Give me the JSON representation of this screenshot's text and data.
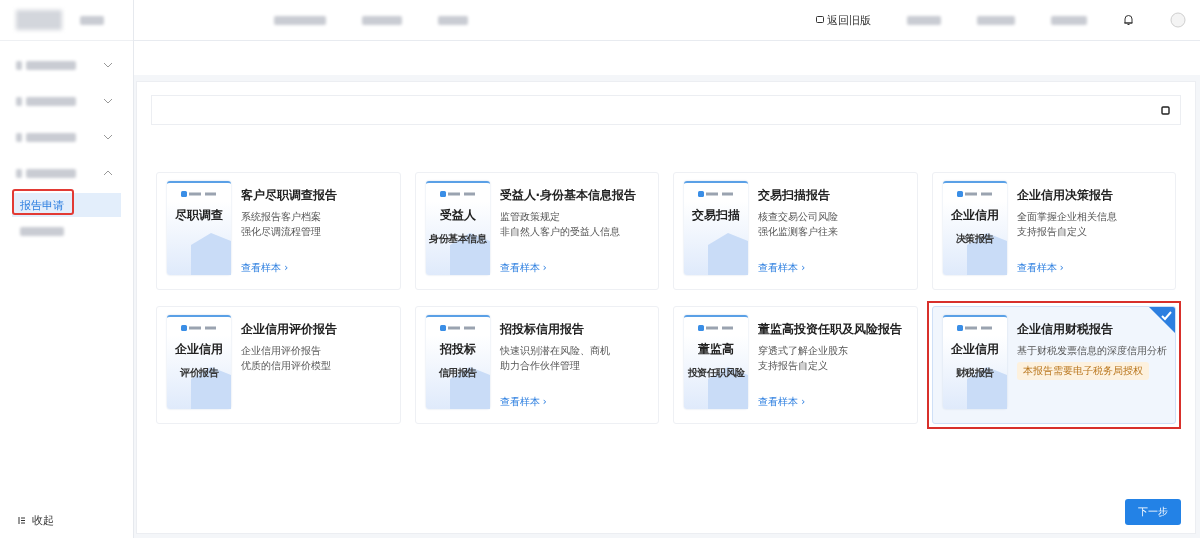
{
  "header": {
    "switch_link": "返回旧版"
  },
  "sidebar": {
    "groups": [
      {
        "expanded": false
      },
      {
        "expanded": false
      },
      {
        "expanded": false
      },
      {
        "expanded": true,
        "children": [
          {
            "label": "报告申请",
            "selected": true,
            "highlighted": true
          },
          {
            "selected": false
          }
        ]
      }
    ],
    "collapse": "收起"
  },
  "reports": [
    {
      "title": "客户尽职调查报告",
      "cover": [
        "尽职调查"
      ],
      "lines": [
        "系统报告客户档案",
        "强化尽调流程管理"
      ],
      "link": "查看样本 ›",
      "selected": false,
      "highlighted": false
    },
    {
      "title": "受益人·身份基本信息报告",
      "cover": [
        "受益人",
        "身份基本信息"
      ],
      "lines": [
        "监管政策规定",
        "非自然人客户的受益人信息"
      ],
      "link": "查看样本 ›",
      "selected": false,
      "highlighted": false
    },
    {
      "title": "交易扫描报告",
      "cover": [
        "交易扫描"
      ],
      "lines": [
        "核查交易公司风险",
        "强化监测客户往来"
      ],
      "link": "查看样本 ›",
      "selected": false,
      "highlighted": false
    },
    {
      "title": "企业信用决策报告",
      "cover": [
        "企业信用",
        "决策报告"
      ],
      "lines": [
        "全面掌握企业相关信息",
        "支持报告自定义"
      ],
      "link": "查看样本 ›",
      "selected": false,
      "highlighted": false
    },
    {
      "title": "企业信用评价报告",
      "cover": [
        "企业信用",
        "评价报告"
      ],
      "lines": [
        "企业信用评价报告",
        "优质的信用评价模型"
      ],
      "selected": false,
      "highlighted": false
    },
    {
      "title": "招投标信用报告",
      "cover": [
        "招投标",
        "信用报告"
      ],
      "lines": [
        "快速识别潜在风险、商机",
        "助力合作伙伴管理"
      ],
      "link": "查看样本 ›",
      "selected": false,
      "highlighted": false
    },
    {
      "title": "董监高投资任职及风险报告",
      "cover": [
        "董监高",
        "投资任职风险"
      ],
      "lines": [
        "穿透式了解企业股东",
        "支持报告自定义"
      ],
      "link": "查看样本 ›",
      "selected": false,
      "highlighted": false
    },
    {
      "title": "企业信用财税报告",
      "cover": [
        "企业信用",
        "财税报告"
      ],
      "lines": [
        "基于财税发票信息的深度信用分析"
      ],
      "notice": "本报告需要电子税务局授权",
      "selected": true,
      "highlighted": true
    }
  ],
  "submit_button": "下一步"
}
